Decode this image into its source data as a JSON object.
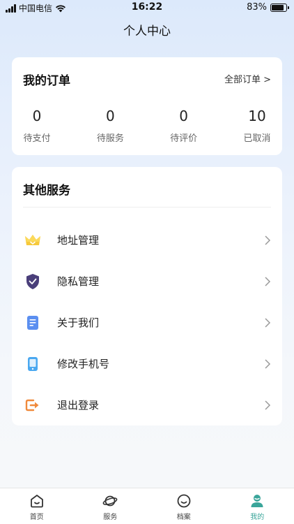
{
  "status_bar": {
    "carrier": "中国电信",
    "time": "16:22",
    "battery": "83%",
    "battery_level": 0.83
  },
  "nav": {
    "title": "个人中心"
  },
  "orders": {
    "title": "我的订单",
    "all_link": "全部订单 >",
    "stats": [
      {
        "value": "0",
        "label": "待支付"
      },
      {
        "value": "0",
        "label": "待服务"
      },
      {
        "value": "0",
        "label": "待评价"
      },
      {
        "value": "10",
        "label": "已取消"
      }
    ]
  },
  "services": {
    "title": "其他服务",
    "items": [
      {
        "label": "地址管理",
        "icon": "crown-icon",
        "color": "#f6c93b"
      },
      {
        "label": "隐私管理",
        "icon": "shield-icon",
        "color": "#4a3f7a"
      },
      {
        "label": "关于我们",
        "icon": "document-icon",
        "color": "#5b8ff0"
      },
      {
        "label": "修改手机号",
        "icon": "phone-icon",
        "color": "#4aa8f0"
      },
      {
        "label": "退出登录",
        "icon": "logout-icon",
        "color": "#f08a3c"
      }
    ]
  },
  "tabs": [
    {
      "label": "首页",
      "icon": "home-icon"
    },
    {
      "label": "服务",
      "icon": "planet-icon"
    },
    {
      "label": "档案",
      "icon": "smile-icon"
    },
    {
      "label": "我的",
      "icon": "user-icon",
      "active": true
    }
  ],
  "colors": {
    "accent": "#3aa59a"
  }
}
